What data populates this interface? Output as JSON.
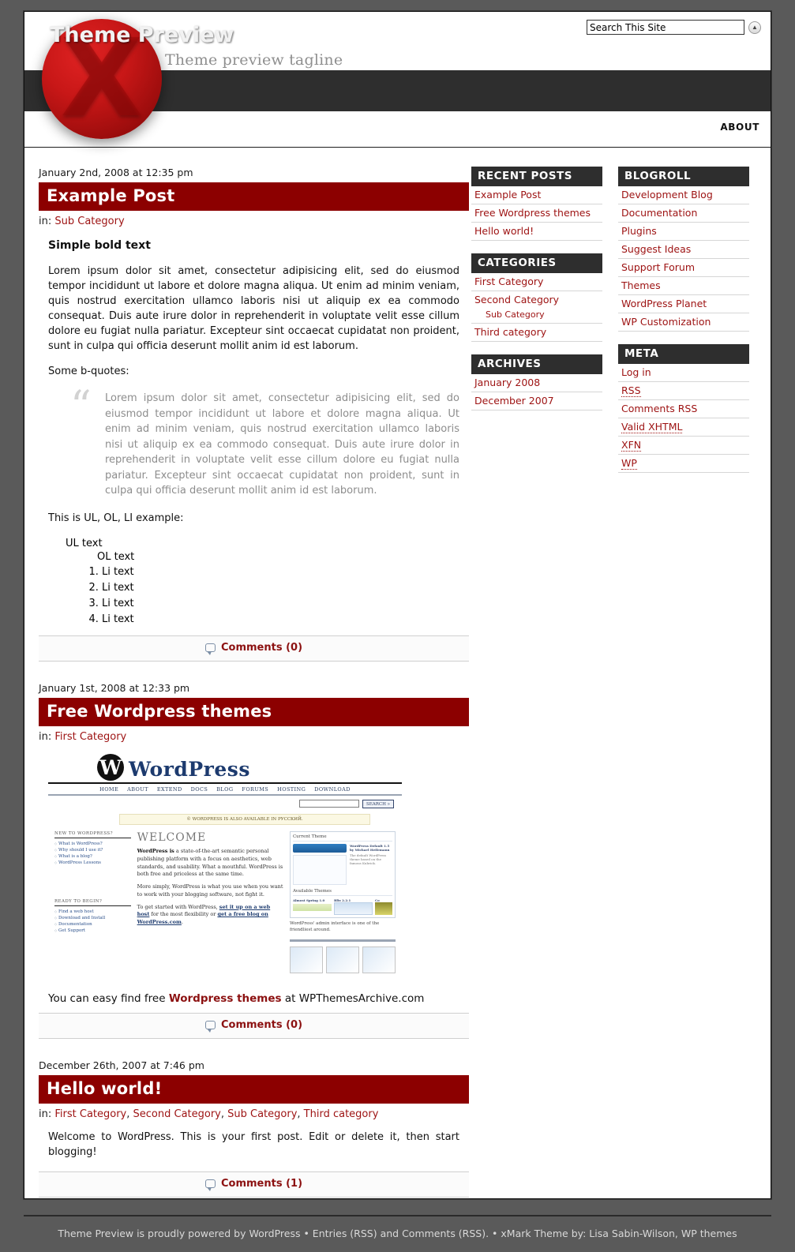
{
  "header": {
    "site_title": "Theme Preview",
    "tagline": "Theme preview tagline",
    "logo_letter": "X",
    "search_value": "Search This Site",
    "search_placeholder": "Search This Site",
    "search_button_glyph": "▲",
    "nav": [
      {
        "label": "ABOUT"
      }
    ]
  },
  "posts": [
    {
      "date": "January 2nd, 2008 at 12:35 pm",
      "title": "Example Post",
      "cats_prefix": "in: ",
      "categories": [
        "Sub Category"
      ],
      "bold_line": "Simple bold text",
      "paragraph1": "Lorem ipsum dolor sit amet, consectetur adipisicing elit, sed do eiusmod tempor incididunt ut labore et dolore magna aliqua. Ut enim ad minim veniam, quis nostrud exercitation ullamco laboris nisi ut aliquip ex ea commodo consequat. Duis aute irure dolor in reprehenderit in voluptate velit esse cillum dolore eu fugiat nulla pariatur. Excepteur sint occaecat cupidatat non proident, sunt in culpa qui officia deserunt mollit anim id est laborum.",
      "quote_intro": "Some b-quotes:",
      "blockquote": "Lorem ipsum dolor sit amet, consectetur adipisicing elit, sed do eiusmod tempor incididunt ut labore et dolore magna aliqua. Ut enim ad minim veniam, quis nostrud exercitation ullamco laboris nisi ut aliquip ex ea commodo consequat. Duis aute irure dolor in reprehenderit in voluptate velit esse cillum dolore eu fugiat nulla pariatur. Excepteur sint occaecat cupidatat non proident, sunt in culpa qui officia deserunt mollit anim id est laborum.",
      "list_intro": "This is UL, OL, LI example:",
      "ul_text": "UL text",
      "ol_text": "OL text",
      "li_items": [
        "Li text",
        "Li text",
        "Li text",
        "Li text"
      ],
      "comments_label": "Comments (0)"
    },
    {
      "date": "January 1st, 2008 at 12:33 pm",
      "title": "Free Wordpress themes",
      "cats_prefix": "in: ",
      "categories": [
        "First Category"
      ],
      "caption_before": "You can easy find free ",
      "caption_bold": "Wordpress themes",
      "caption_after": " at WPThemesArchive.com",
      "comments_label": "Comments (0)"
    },
    {
      "date": "December 26th, 2007 at 7:46 pm",
      "title": "Hello world!",
      "cats_prefix": "in: ",
      "categories": [
        "First Category",
        "Second Category",
        "Sub Category",
        "Third category"
      ],
      "paragraph1": "Welcome to WordPress. This is your first post. Edit or delete it, then start blogging!",
      "comments_label": "Comments (1)"
    }
  ],
  "wp_screenshot": {
    "brand_mark": "W",
    "brand_word": "ORD",
    "brand_word2": "RESS",
    "brand_p": "P",
    "brand_full": "WordPress",
    "nav": [
      "HOME",
      "ABOUT",
      "EXTEND",
      "DOCS",
      "BLOG",
      "FORUMS",
      "HOSTING",
      "DOWNLOAD"
    ],
    "search_button": "SEARCH »",
    "banner": "© WORDPRESS IS ALSO AVAILABLE IN РУССКИЙ.",
    "left_box1_title": "NEW TO WORDPRESS?",
    "left_box1_links": [
      "What is WordPress?",
      "Why should I use it?",
      "What is a blog?",
      "WordPress Lessons"
    ],
    "left_box2_title": "READY TO BEGIN?",
    "left_box2_links": [
      "Find a web host",
      "Download and Install",
      "Documentation",
      "Get Support"
    ],
    "welcome": "WELCOME",
    "p1_bold": "WordPress is",
    "p1": " a state-of-the-art semantic personal publishing platform with a focus on aesthetics, web standards, and usability. What a mouthful. WordPress is both free and priceless at the same time.",
    "p2": "More simply, WordPress is what you use when you want to work with your blogging software, not fight it.",
    "p3_before": "To get started with WordPress, ",
    "p3_link1": "set it up on a web host",
    "p3_mid": " for the most flexibility or ",
    "p3_link2": "get a free blog on WordPress.com",
    "p3_end": ".",
    "panel_title": "Current Theme",
    "panel_sub": "WordPress Default 1.5 by Michael Heilemann",
    "panel_note": "The default WordPress theme based on the famous Kubrick.",
    "panel_avail": "Available Themes",
    "theme_names": [
      "Almost Spring 1.0",
      "Blix 2.2.1",
      "Co"
    ],
    "caption": "WordPress' admin interface is one of the friendliest around."
  },
  "sidebar_left": [
    {
      "title": "RECENT POSTS",
      "items": [
        {
          "label": "Example Post",
          "sub": false,
          "dotted": false
        },
        {
          "label": "Free Wordpress themes",
          "sub": false,
          "dotted": false
        },
        {
          "label": "Hello world!",
          "sub": false,
          "dotted": false
        }
      ]
    },
    {
      "title": "CATEGORIES",
      "items": [
        {
          "label": "First Category",
          "sub": false,
          "dotted": false
        },
        {
          "label": "Second Category",
          "sub": false,
          "dotted": false
        },
        {
          "label": "Sub Category",
          "sub": true,
          "dotted": false
        },
        {
          "label": "Third category",
          "sub": false,
          "dotted": false
        }
      ]
    },
    {
      "title": "ARCHIVES",
      "items": [
        {
          "label": "January 2008",
          "sub": false,
          "dotted": false
        },
        {
          "label": "December 2007",
          "sub": false,
          "dotted": false
        }
      ]
    }
  ],
  "sidebar_right": [
    {
      "title": "BLOGROLL",
      "items": [
        {
          "label": "Development Blog",
          "sub": false,
          "dotted": false
        },
        {
          "label": "Documentation",
          "sub": false,
          "dotted": false
        },
        {
          "label": "Plugins",
          "sub": false,
          "dotted": false
        },
        {
          "label": "Suggest Ideas",
          "sub": false,
          "dotted": false
        },
        {
          "label": "Support Forum",
          "sub": false,
          "dotted": false
        },
        {
          "label": "Themes",
          "sub": false,
          "dotted": false
        },
        {
          "label": "WordPress Planet",
          "sub": false,
          "dotted": false
        },
        {
          "label": "WP Customization",
          "sub": false,
          "dotted": false
        }
      ]
    },
    {
      "title": "META",
      "items": [
        {
          "label": "Log in",
          "sub": false,
          "dotted": false
        },
        {
          "label": "RSS",
          "sub": false,
          "dotted": true
        },
        {
          "label": "Comments RSS",
          "sub": false,
          "dotted": false
        },
        {
          "label": "Valid XHTML",
          "sub": false,
          "dotted": true
        },
        {
          "label": "XFN",
          "sub": false,
          "dotted": true
        },
        {
          "label": "WP",
          "sub": false,
          "dotted": true
        }
      ]
    }
  ],
  "footer": {
    "text": "Theme Preview is proudly powered by WordPress • Entries (RSS) and Comments (RSS). • xMark Theme by: Lisa Sabin-Wilson, WP themes"
  },
  "colors": {
    "accent_red": "#8c0000",
    "link_red": "#9d1212",
    "dark_band": "#2e2e2e",
    "page_bg": "#5a5a5a"
  }
}
